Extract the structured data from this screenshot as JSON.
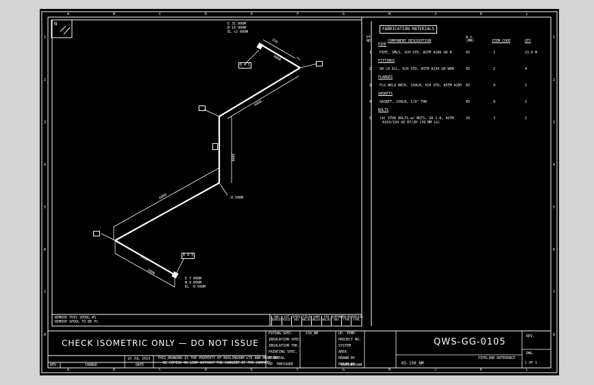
{
  "colors": {
    "background": "#d4d4d4",
    "paper": "#000000",
    "ink": "#ffffff"
  },
  "border": {
    "top_letters": [
      "A",
      "B",
      "C",
      "D",
      "E",
      "F",
      "G",
      "H",
      "J",
      "K",
      "L"
    ],
    "side_numbers": [
      "1",
      "2",
      "3",
      "4",
      "5",
      "6",
      "7",
      "8"
    ]
  },
  "north_label": "N",
  "iso": {
    "coord_top": [
      "E 31 000M",
      "N 14 000M",
      "EL +2 000M"
    ],
    "coord_bottom": [
      "E 7 000M",
      "N 9 000M",
      "EL -0 500M"
    ],
    "elev_label": "-0.500M",
    "dims": [
      "150",
      "4000",
      "4000",
      "3000",
      "6000",
      "1500",
      "2000"
    ],
    "tags": [
      "6 4 1",
      "6 4 3"
    ],
    "note_lines": [
      "REMOVE THIS SPOOL #1",
      "REMOVE SPOOL TO BE PC"
    ]
  },
  "fabrication": {
    "title": "FABRICATION MATERIALS",
    "headers": {
      "pt_no": "PT NO",
      "description": "COMPONENT DESCRIPTION",
      "ns": "N.S. (MM)",
      "item_code": "ITEM CODE",
      "qty": "QTY"
    },
    "sections": [
      {
        "name": "PIPE",
        "rows": [
          {
            "pt": "1",
            "desc": [
              "PIPE, SMLS, SCH STD, ASTM A106 GR B"
            ],
            "ns": "65",
            "code": "1",
            "qty": "23.0 M"
          }
        ]
      },
      {
        "name": "FITTINGS",
        "rows": [
          {
            "pt": "2",
            "desc": [
              "90 LR ELL, SCH STD, ASTM A234 GR WPB"
            ],
            "ns": "65",
            "code": "2",
            "qty": "4"
          }
        ]
      },
      {
        "name": "FLANGES",
        "rows": [
          {
            "pt": "3",
            "desc": [
              "FLG WELD NECK, 150LB, SCH STD, ASTM A105"
            ],
            "ns": "65",
            "code": "9",
            "qty": "2"
          }
        ]
      },
      {
        "name": "GASKETS",
        "rows": [
          {
            "pt": "4",
            "desc": [
              "GASKET, 150LB, 1/8\" THK"
            ],
            "ns": "65",
            "code": "8",
            "qty": "2"
          }
        ]
      },
      {
        "name": "BOLTS",
        "rows": [
          {
            "pt": "5",
            "desc": [
              "(4) STUD BOLTS w/ NUTS, GR 1.0, ASTM",
              "A193/194 GR B7/2H (59 MM LG)"
            ],
            "ns": "16",
            "code": "7",
            "qty": "2"
          }
        ]
      }
    ]
  },
  "footer_cells": [
    "DWG SERIES",
    "CUT PIECE",
    "SPOOL NOS",
    "FIELD WELDS",
    "SHOP WELDS",
    "FAB WELDS",
    "SUPPORT NOS",
    "VALVE TYPE",
    "INSULAT TYPE"
  ],
  "title_block": {
    "status": "CHECK ISOMETRIC ONLY — DO NOT ISSUE",
    "labels_a": [
      "PIPING SPEC.",
      "INSULATION SPEC.",
      "INSULATION THK.",
      "PAINTING SPEC.",
      "MATERIAL",
      "OP. PRESSURE"
    ],
    "value_a": "150_NM",
    "labels_b": [
      "OP. TEMP.",
      "PROJECT NO.",
      "SYSTEM",
      "AREA",
      "DRAWN BY",
      "DRAWN BY"
    ],
    "value_b": "ELAINHAVAN",
    "dwg_no": "QWS-GG-0105",
    "rev_label": "REV.",
    "pipeline_ref_label": "PIPELINE REFERENCE",
    "pipeline_ref": "65-150_NM",
    "dwg_label": "DWG.",
    "sheet": "1 OF 1",
    "date": "16 JUL 2019",
    "rev_col": "REV.",
    "change_col": "CHANGE",
    "date_col": "DATE",
    "notice_lines": [
      "THIS DRAWING IS THE PROPERTY OF ROSLINGHAM LTD AND MUST NOT",
      "BE COPIED OR LENT WITHOUT THE CONSENT OF THE COMPANY"
    ]
  }
}
